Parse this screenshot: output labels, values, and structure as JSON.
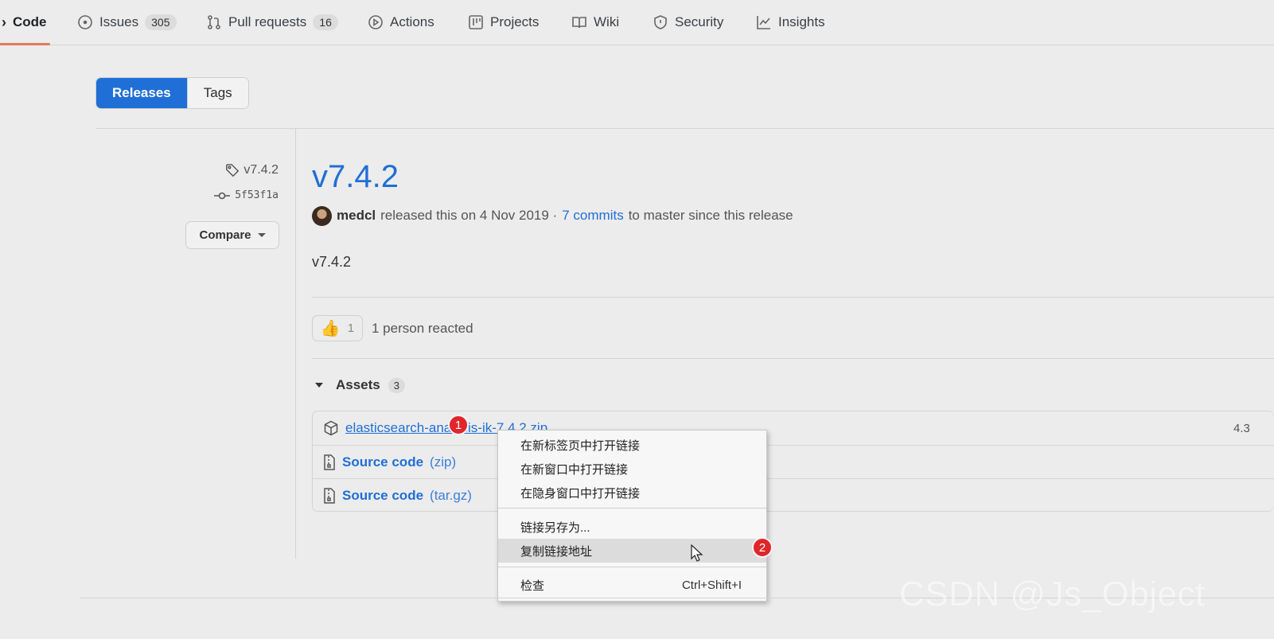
{
  "nav": {
    "code": "Code",
    "issues": "Issues",
    "issues_count": "305",
    "pull_requests": "Pull requests",
    "pull_requests_count": "16",
    "actions": "Actions",
    "projects": "Projects",
    "wiki": "Wiki",
    "security": "Security",
    "insights": "Insights"
  },
  "toggle": {
    "releases": "Releases",
    "tags": "Tags"
  },
  "sidebar": {
    "tag": "v7.4.2",
    "commit": "5f53f1a",
    "compare": "Compare"
  },
  "release": {
    "title": "v7.4.2",
    "author": "medcl",
    "released_text": "released this on 4 Nov 2019 ·",
    "commits_link": "7 commits",
    "commits_suffix": "to master since this release",
    "body": "v7.4.2",
    "reaction_count": "1",
    "reaction_text": "1 person reacted"
  },
  "assets": {
    "label": "Assets",
    "count": "3",
    "items": [
      {
        "name": "elasticsearch-analysis-ik-7.4.2.zip",
        "size": "4.3"
      },
      {
        "name": "Source code",
        "suffix": "(zip)"
      },
      {
        "name": "Source code",
        "suffix": "(tar.gz)"
      }
    ]
  },
  "markers": {
    "step1": "1",
    "step2": "2"
  },
  "context_menu": {
    "items": [
      {
        "label": "在新标签页中打开链接"
      },
      {
        "label": "在新窗口中打开链接"
      },
      {
        "label": "在隐身窗口中打开链接"
      },
      {
        "label": "链接另存为..."
      },
      {
        "label": "复制链接地址"
      },
      {
        "label": "检查",
        "shortcut": "Ctrl+Shift+I"
      }
    ]
  },
  "watermark": "CSDN @Js_Object",
  "colors": {
    "accent": "#1f6fd6",
    "selected_underline": "#e4785b",
    "marker": "#e0262b"
  }
}
